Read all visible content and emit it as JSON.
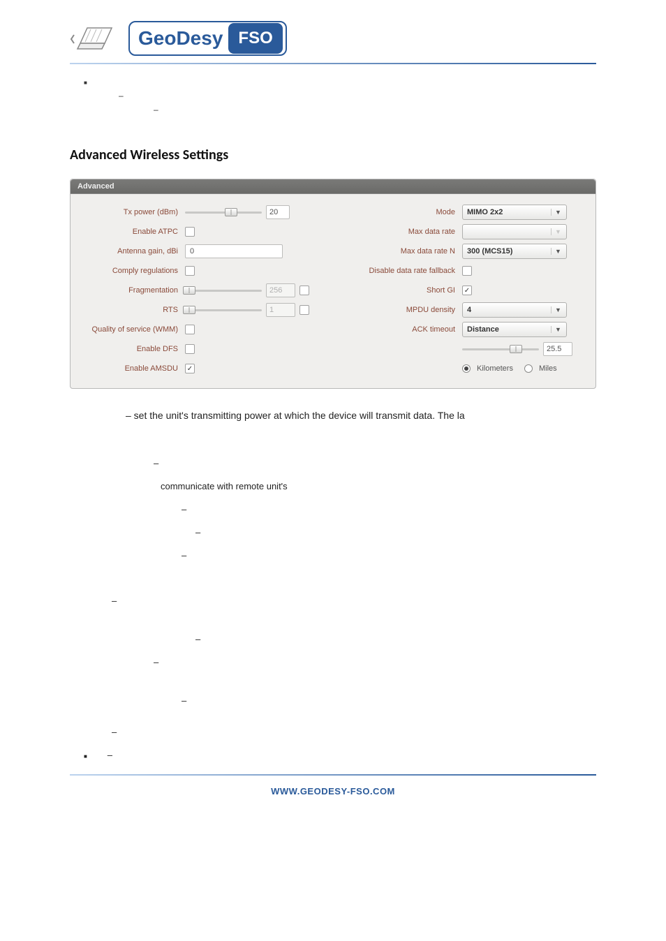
{
  "logo": {
    "brand": "GeoDesy",
    "tag": "FSO"
  },
  "section_title": "Advanced Wireless Settings",
  "panel": {
    "title": "Advanced",
    "left": {
      "tx_power_label": "Tx power (dBm)",
      "tx_power_value": "20",
      "enable_atpc_label": "Enable ATPC",
      "enable_atpc_checked": false,
      "antenna_gain_label": "Antenna gain, dBi",
      "antenna_gain_value": "0",
      "comply_label": "Comply regulations",
      "comply_checked": false,
      "frag_label": "Fragmentation",
      "frag_value": "256",
      "frag_cb_checked": false,
      "rts_label": "RTS",
      "rts_value": "1",
      "rts_cb_checked": false,
      "qos_label": "Quality of service (WMM)",
      "qos_checked": false,
      "dfs_label": "Enable DFS",
      "dfs_checked": false,
      "amsdu_label": "Enable AMSDU",
      "amsdu_checked": true
    },
    "right": {
      "mode_label": "Mode",
      "mode_value": "MIMO 2x2",
      "max_rate_label": "Max data rate",
      "max_rate_value": "",
      "max_rate_n_label": "Max data rate N",
      "max_rate_n_value": "300 (MCS15)",
      "disable_fb_label": "Disable data rate fallback",
      "disable_fb_checked": false,
      "short_gi_label": "Short GI",
      "short_gi_checked": true,
      "mpdu_label": "MPDU density",
      "mpdu_value": "4",
      "ack_label": "ACK timeout",
      "ack_select_value": "Distance",
      "ack_slider_value": "25.5",
      "unit_km_label": "Kilometers",
      "unit_mi_label": "Miles",
      "unit_selected": "km"
    }
  },
  "body_line": "– set the unit's transmitting power at which the device will transmit data. The la",
  "sub_line": "communicate with remote unit's",
  "footer": "WWW.GEODESY-FSO.COM"
}
